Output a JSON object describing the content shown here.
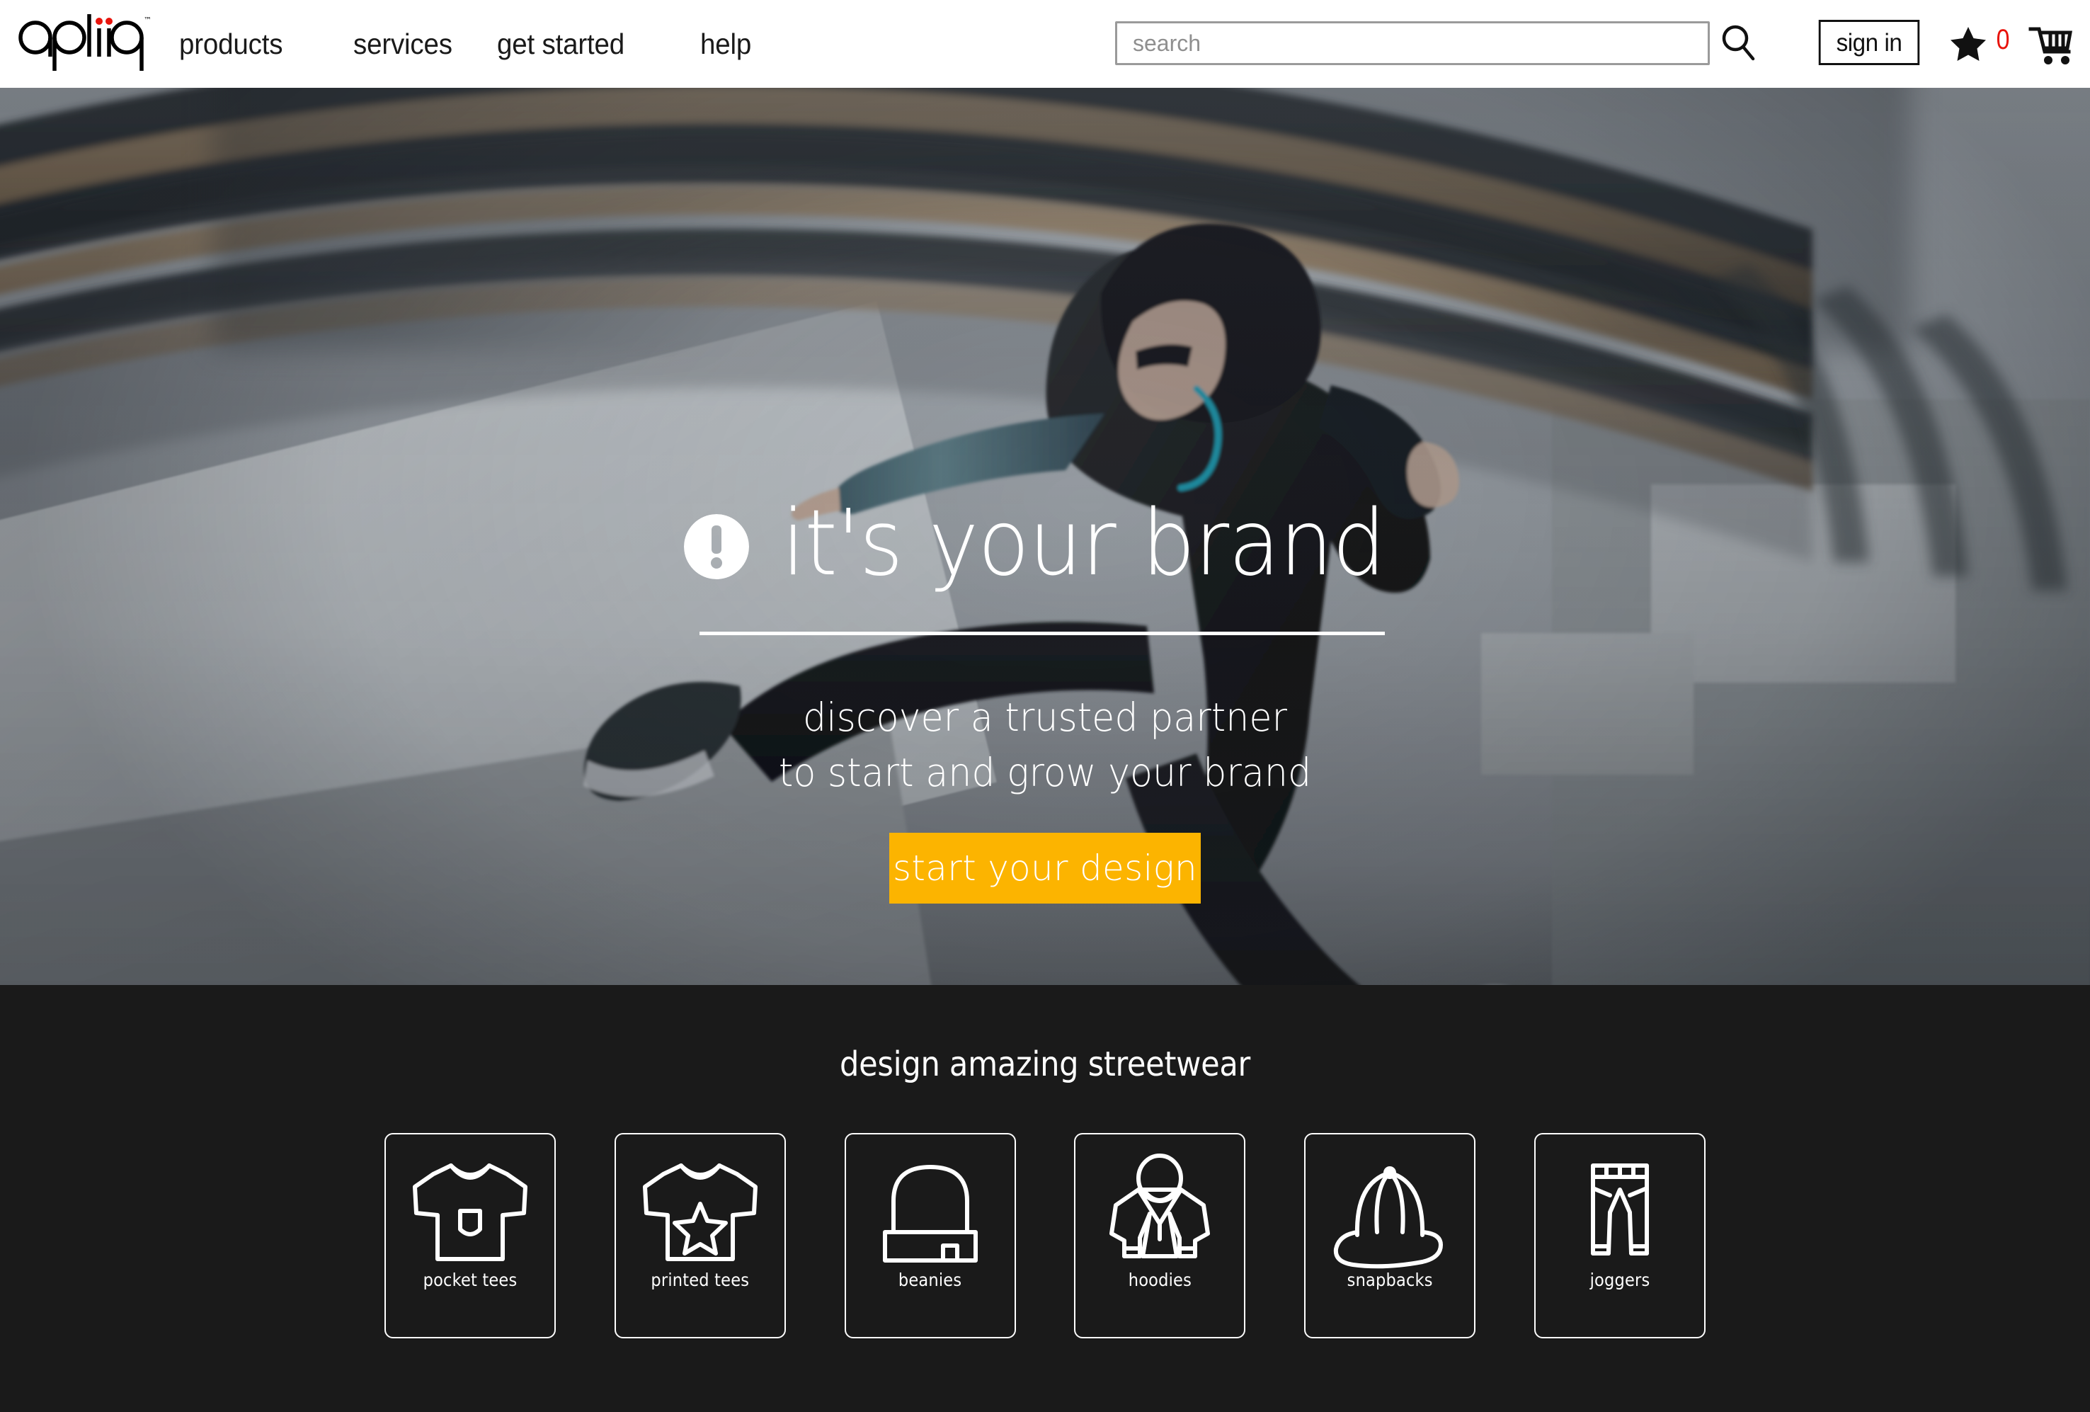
{
  "header": {
    "logo": {
      "text": "apliiq",
      "trademark": "™",
      "dot_color": "#e8140c"
    },
    "nav": [
      {
        "label": "products"
      },
      {
        "label": "services"
      },
      {
        "label": "get started"
      },
      {
        "label": "help"
      }
    ],
    "search": {
      "placeholder": "search",
      "value": "",
      "icon": "search-icon"
    },
    "sign_in_label": "sign in",
    "favorites_icon": "star-icon",
    "cart_icon": "shopping-cart-icon",
    "cart_count": "0",
    "cart_count_color": "#e8140c"
  },
  "hero": {
    "alert_icon": "exclamation-circle-icon",
    "title": "it's your brand",
    "subtitle_line1": "discover a trusted partner",
    "subtitle_line2": "to start and grow your brand",
    "cta_label": "start your design",
    "cta_color": "#FCB400"
  },
  "categories": {
    "heading": "design amazing streetwear",
    "background": "#1a1a1a",
    "items": [
      {
        "label": "pocket tees",
        "icon": "tshirt-pocket-icon"
      },
      {
        "label": "printed tees",
        "icon": "tshirt-star-icon"
      },
      {
        "label": "beanies",
        "icon": "beanie-icon"
      },
      {
        "label": "hoodies",
        "icon": "hoodie-icon"
      },
      {
        "label": "snapbacks",
        "icon": "snapback-cap-icon"
      },
      {
        "label": "joggers",
        "icon": "joggers-pants-icon"
      }
    ]
  }
}
